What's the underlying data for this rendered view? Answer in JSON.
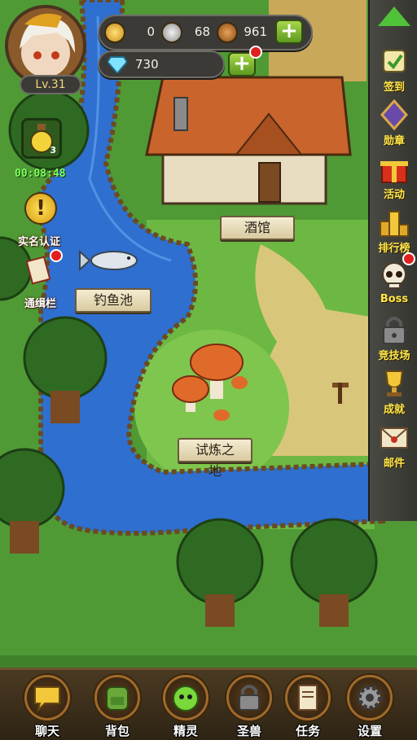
{
  "player": {
    "level": "Lv.31",
    "gold": "0",
    "silver": "68",
    "bronze": "961",
    "diamonds": "730"
  },
  "left_panel": {
    "potion_count": "3",
    "timer": "00:08:48",
    "realname_label": "实名认证",
    "wanted_label": "通缉栏"
  },
  "map_labels": {
    "tavern": "酒馆",
    "fishing_pond": "钓鱼池",
    "trial_ground": "试炼之地"
  },
  "sidebar": {
    "items": [
      {
        "label": "签到",
        "icon": "scroll-icon"
      },
      {
        "label": "勋章",
        "icon": "medal-icon"
      },
      {
        "label": "活动",
        "icon": "gift-icon"
      },
      {
        "label": "排行榜",
        "icon": "podium-icon"
      },
      {
        "label": "Boss",
        "icon": "skull-icon"
      },
      {
        "label": "竞技场",
        "icon": "lock-icon"
      },
      {
        "label": "成就",
        "icon": "trophy-icon"
      },
      {
        "label": "邮件",
        "icon": "mail-icon"
      }
    ]
  },
  "bottom_bar": {
    "items": [
      {
        "label": "聊天",
        "icon": "chat-icon"
      },
      {
        "label": "背包",
        "icon": "backpack-icon"
      },
      {
        "label": "精灵",
        "icon": "spirit-icon"
      },
      {
        "label": "圣兽",
        "icon": "beast-icon"
      },
      {
        "label": "任务",
        "icon": "quest-scroll-icon"
      },
      {
        "label": "设置",
        "icon": "gear-icon"
      }
    ]
  },
  "colors": {
    "grass": "#5aa63a",
    "river": "#2f6fd0",
    "path": "#d9c97a",
    "accent_yellow": "#ffe84a"
  }
}
